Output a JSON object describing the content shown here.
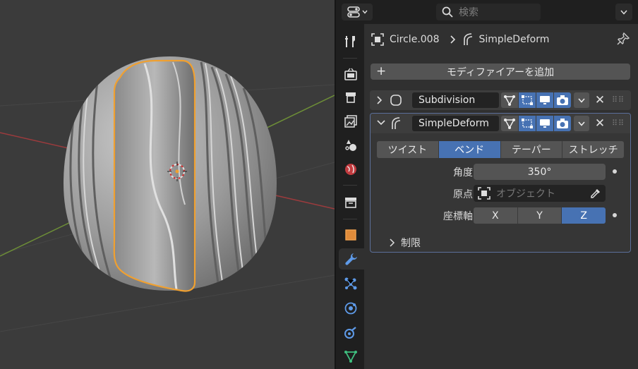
{
  "header": {
    "search_placeholder": "検索"
  },
  "breadcrumb": {
    "object": "Circle.008",
    "modifier": "SimpleDeform"
  },
  "add_modifier_label": "モディファイアーを追加",
  "modifiers": [
    {
      "name": "Subdivision",
      "expanded": false
    },
    {
      "name": "SimpleDeform",
      "expanded": true
    }
  ],
  "simple_deform": {
    "modes": [
      "ツイスト",
      "ベンド",
      "テーパー",
      "ストレッチ"
    ],
    "active_mode": "ベンド",
    "angle_label": "角度",
    "angle_value": "350°",
    "origin_label": "原点",
    "origin_placeholder": "オブジェクト",
    "axis_label": "座標軸",
    "axes": [
      "X",
      "Y",
      "Z"
    ],
    "active_axis": "Z",
    "limits_label": "制限"
  },
  "colors": {
    "accent_blue": "#4772b3",
    "selection_orange": "#f0a030",
    "viewport_bg": "#3b3b3b",
    "x_axis": "#c0393b",
    "y_axis": "#6d9a2e"
  }
}
